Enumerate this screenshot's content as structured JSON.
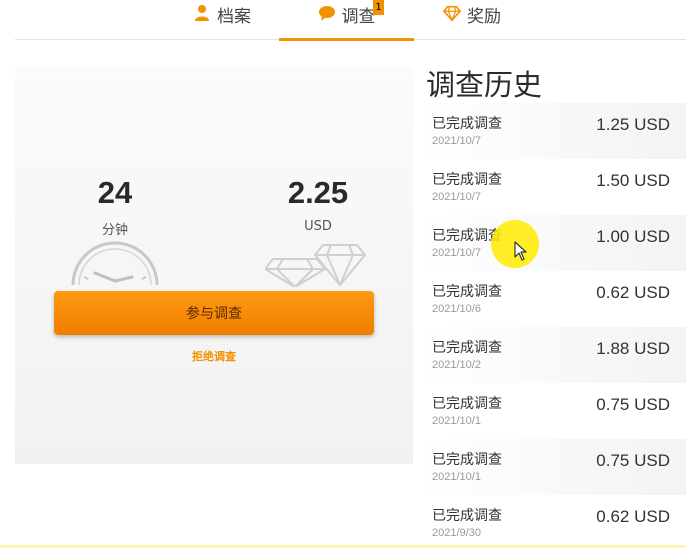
{
  "tabs": [
    {
      "label": "档案",
      "icon": "person-icon"
    },
    {
      "label": "调查",
      "icon": "speech-bubble-icon",
      "badge": "1",
      "active": true
    },
    {
      "label": "奖励",
      "icon": "diamond-icon"
    }
  ],
  "survey": {
    "duration_value": "24",
    "duration_unit": "分钟",
    "reward_value": "2.25",
    "reward_unit": "USD",
    "take_button": "参与调查",
    "decline_link": "拒绝调查"
  },
  "history": {
    "title": "调查历史",
    "rows": [
      {
        "status": "已完成调查",
        "date": "2021/10/7",
        "amount": "1.25 USD"
      },
      {
        "status": "已完成调查",
        "date": "2021/10/7",
        "amount": "1.50 USD"
      },
      {
        "status": "已完成调查",
        "date": "2021/10/7",
        "amount": "1.00 USD"
      },
      {
        "status": "已完成调查",
        "date": "2021/10/6",
        "amount": "0.62 USD"
      },
      {
        "status": "已完成调查",
        "date": "2021/10/2",
        "amount": "1.88 USD"
      },
      {
        "status": "已完成调查",
        "date": "2021/10/1",
        "amount": "0.75 USD"
      },
      {
        "status": "已完成调查",
        "date": "2021/10/1",
        "amount": "0.75 USD"
      },
      {
        "status": "已完成调查",
        "date": "2021/9/30",
        "amount": "0.62 USD"
      }
    ]
  },
  "colors": {
    "accent": "#f39200",
    "cursor_highlight": "#ffeb00"
  }
}
